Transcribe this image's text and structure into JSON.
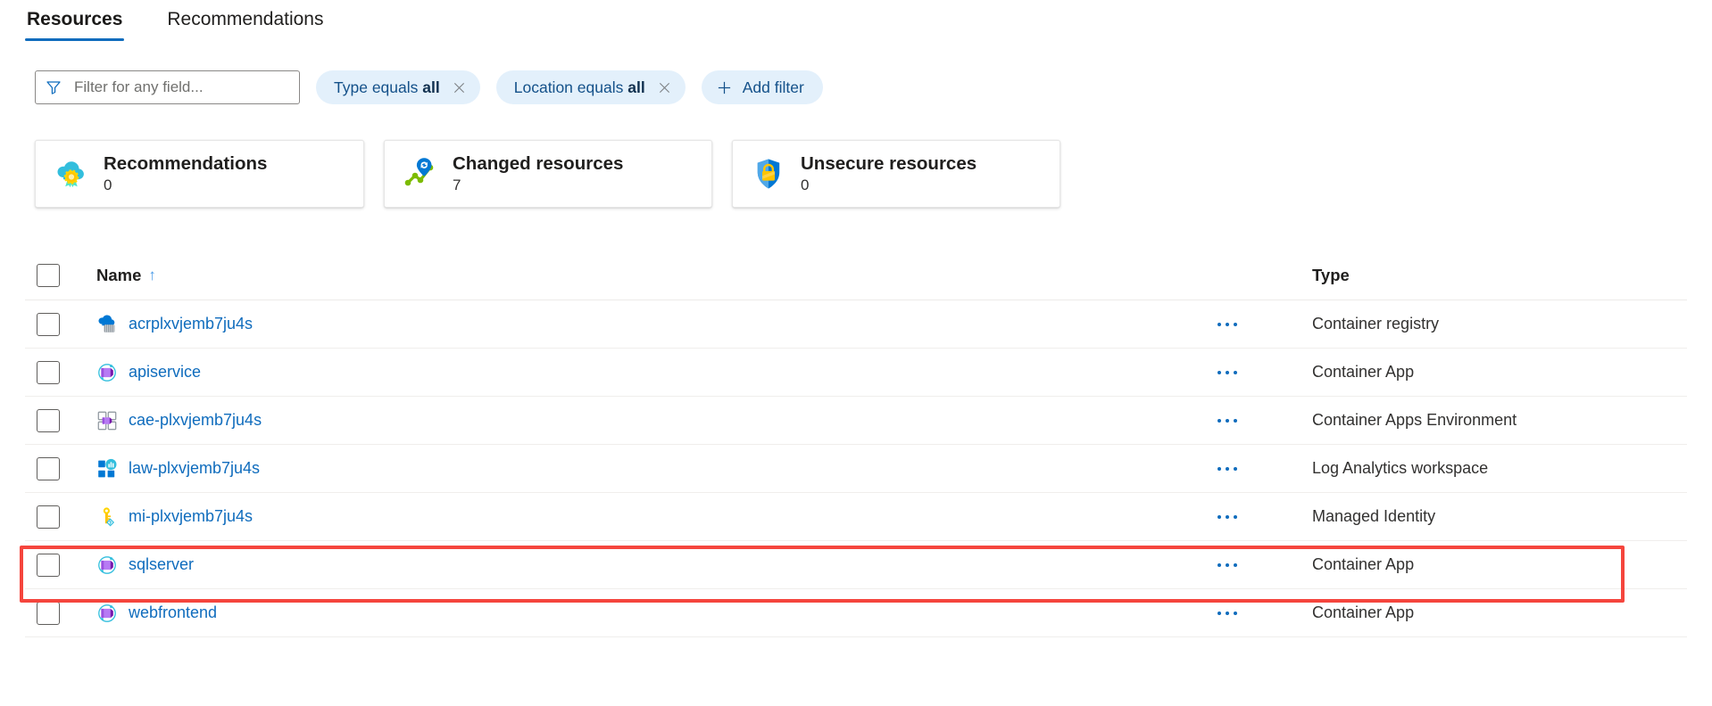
{
  "tabs": [
    {
      "label": "Resources",
      "active": true
    },
    {
      "label": "Recommendations",
      "active": false
    }
  ],
  "filter_bar": {
    "search_placeholder": "Filter for any field...",
    "search_value": "",
    "funnel_icon": "funnel-icon",
    "pills": [
      {
        "field": "Type",
        "operator": "equals",
        "value": "all",
        "close_icon": "close-icon"
      },
      {
        "field": "Location",
        "operator": "equals",
        "value": "all",
        "close_icon": "close-icon"
      }
    ],
    "add_filter_label": "Add filter",
    "add_filter_icon": "plus-icon"
  },
  "summary_cards": [
    {
      "title": "Recommendations",
      "count": "0",
      "icon": "recommendations-cloud-ribbon-icon"
    },
    {
      "title": "Changed resources",
      "count": "7",
      "icon": "changed-resources-chart-pin-icon"
    },
    {
      "title": "Unsecure resources",
      "count": "0",
      "icon": "unsecure-resources-shield-lock-icon"
    }
  ],
  "table": {
    "columns": {
      "name": "Name",
      "type": "Type"
    },
    "sort_indicator": "↑",
    "rows": [
      {
        "name": "acrplxvjemb7ju4s",
        "type": "Container registry",
        "icon": "container-registry-icon",
        "highlighted": false
      },
      {
        "name": "apiservice",
        "type": "Container App",
        "icon": "container-app-icon",
        "highlighted": false
      },
      {
        "name": "cae-plxvjemb7ju4s",
        "type": "Container Apps Environment",
        "icon": "container-apps-environment-icon",
        "highlighted": false
      },
      {
        "name": "law-plxvjemb7ju4s",
        "type": "Log Analytics workspace",
        "icon": "log-analytics-workspace-icon",
        "highlighted": false
      },
      {
        "name": "mi-plxvjemb7ju4s",
        "type": "Managed Identity",
        "icon": "managed-identity-key-icon",
        "highlighted": false
      },
      {
        "name": "sqlserver",
        "type": "Container App",
        "icon": "container-app-icon",
        "highlighted": true
      },
      {
        "name": "webfrontend",
        "type": "Container App",
        "icon": "container-app-icon",
        "highlighted": false
      }
    ]
  },
  "colors": {
    "accent_blue": "#0f6cbd",
    "link_blue": "#0f6cbd",
    "pill_bg": "#e3f0fb",
    "highlight_red": "#f5453d",
    "text_primary": "#201f1e"
  }
}
